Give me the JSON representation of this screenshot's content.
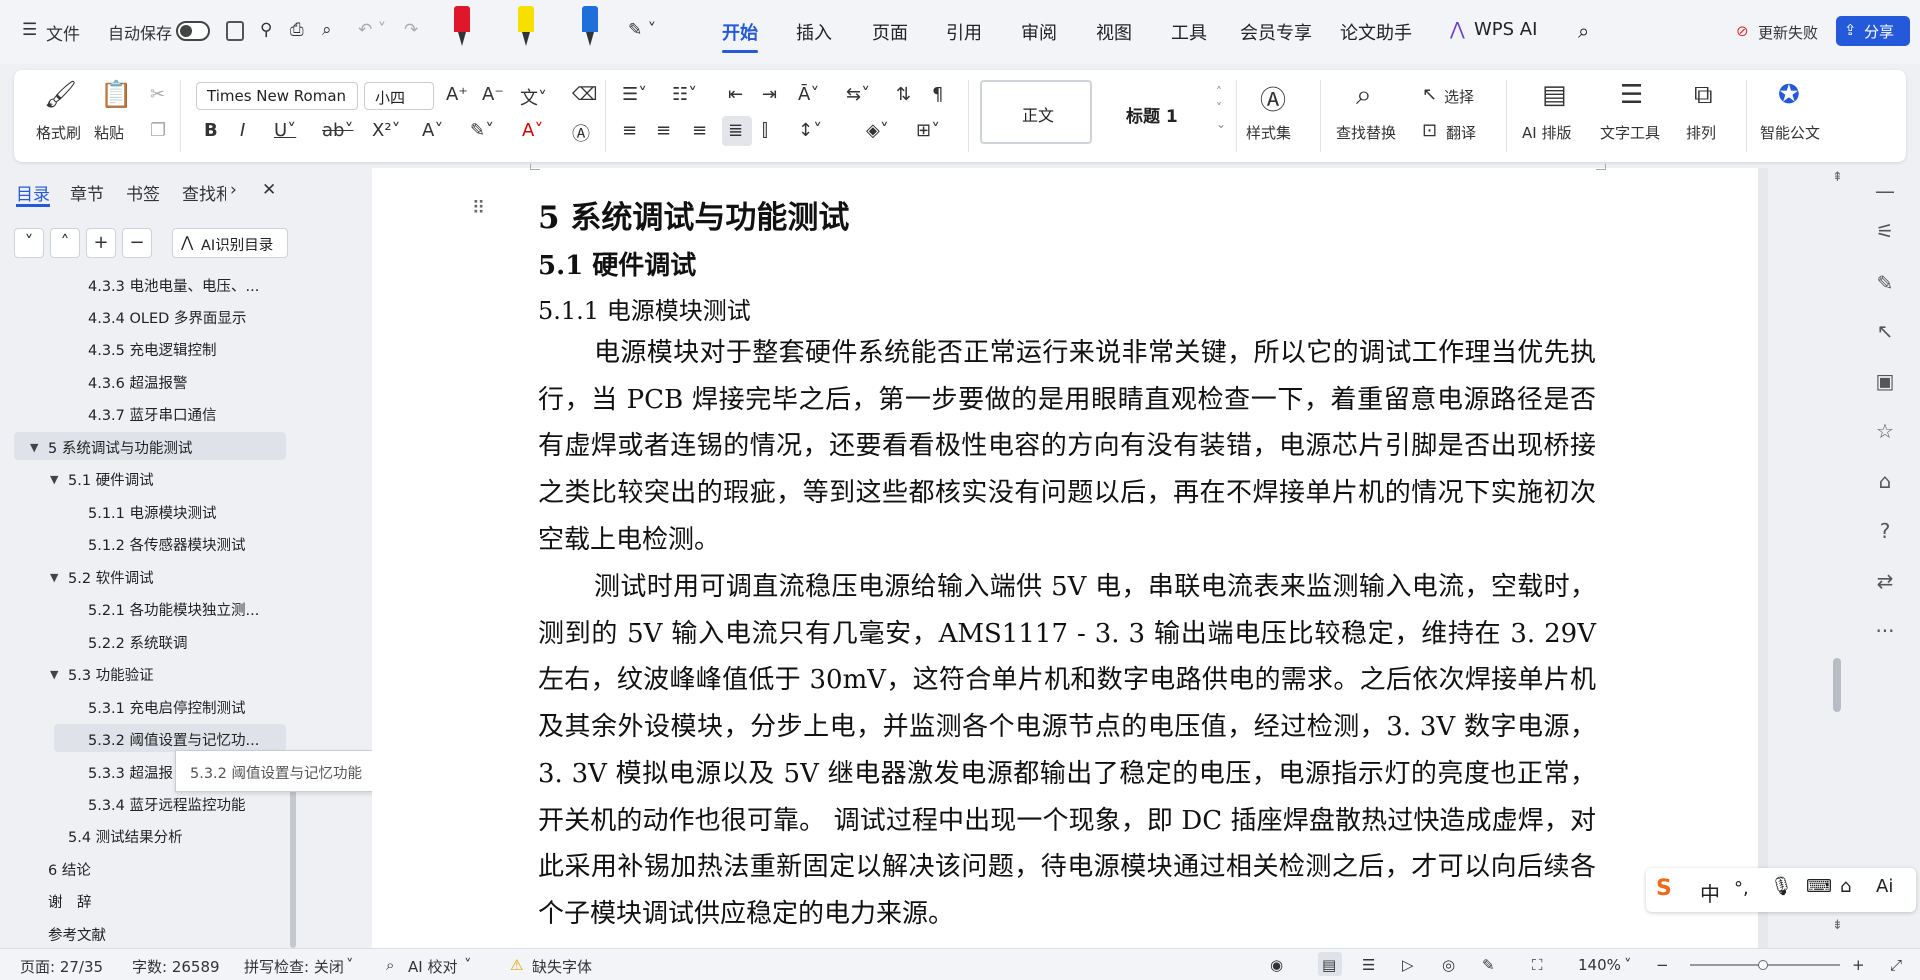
{
  "topbar": {
    "menu_label": "文件",
    "autosave_label": "自动保存",
    "tabs": [
      "开始",
      "插入",
      "页面",
      "引用",
      "审阅",
      "视图",
      "工具",
      "会员专享",
      "论文助手",
      "WPS AI"
    ],
    "update_failed": "更新失败",
    "share": "分享"
  },
  "ribbon": {
    "format_painter": "格式刷",
    "paste": "粘贴",
    "font_name": "Times New Roman",
    "font_size": "小四",
    "style_normal": "正文",
    "style_heading": "标题 1",
    "style_set": "样式集",
    "find_replace": "查找替换",
    "select": "选择",
    "translate": "翻译",
    "ai_layout": "AI 排版",
    "text_tools": "文字工具",
    "arrange": "排列",
    "smart_doc": "智能公文"
  },
  "leftpanel": {
    "tabs": [
      "目录",
      "章节",
      "书签",
      "查找和"
    ],
    "ai_toc": "AI识别目录",
    "toc": [
      "4.3.3  电池电量、电压、...",
      "4.3.4  OLED 多界面显示",
      "4.3.5  充电逻辑控制",
      "4.3.6  超温报警",
      "4.3.7  蓝牙串口通信",
      "5 系统调试与功能测试",
      "5.1  硬件调试",
      "5.1.1  电源模块测试",
      "5.1.2  各传感器模块测试",
      "5.2  软件调试",
      "5.2.1  各功能模块独立测...",
      "5.2.2  系统联调",
      "5.3  功能验证",
      "5.3.1  充电启停控制测试",
      "5.3.2  阈值设置与记忆功...",
      "5.3.3  超温报",
      "5.3.4  蓝牙远程监控功能",
      "5.4  测试结果分析",
      "6 结论",
      "谢　辞",
      "参考文献"
    ],
    "tooltip": "5.3.2 阈值设置与记忆功能"
  },
  "document": {
    "h1": "5 系统调试与功能测试",
    "h2": "5.1  硬件调试",
    "h3": "5.1.1  电源模块测试",
    "p1": "电源模块对于整套硬件系统能否正常运行来说非常关键，所以它的调试工作理当优先执行，当 PCB 焊接完毕之后，第一步要做的是用眼睛直观检查一下，着重留意电源路径是否有虚焊或者连锡的情况，还要看看极性电容的方向有没有装错，电源芯片引脚是否出现桥接之类比较突出的瑕疵，等到这些都核实没有问题以后，再在不焊接单片机的情况下实施初次空载上电检测。",
    "p2": "测试时用可调直流稳压电源给输入端供 5V 电，串联电流表来监测输入电流，空载时，测到的 5V 输入电流只有几毫安，AMS1117 - 3. 3 输出端电压比较稳定，维持在 3. 29V 左右，纹波峰峰值低于 30mV，这符合单片机和数字电路供电的需求。之后依次焊接单片机及其余外设模块，分步上电，并监测各个电源节点的电压值，经过检测，3. 3V 数字电源，3. 3V 模拟电源以及 5V 继电器激发电源都输出了稳定的电压，电源指示灯的亮度也正常，开关机的动作也很可靠。 调试过程中出现一个现象，即 DC 插座焊盘散热过快造成虚焊，对此采用补锡加热法重新固定以解决该问题，待电源模块通过相关检测之后，才可以向后续各个子模块调试供应稳定的电力来源。"
  },
  "status": {
    "page": "页面: 27/35",
    "words": "字数: 26589",
    "spell": "拼写检查: 关闭",
    "ai_check": "AI 校对",
    "missing_font": "缺失字体",
    "zoom": "140%"
  },
  "ime": {
    "lang": "中"
  }
}
